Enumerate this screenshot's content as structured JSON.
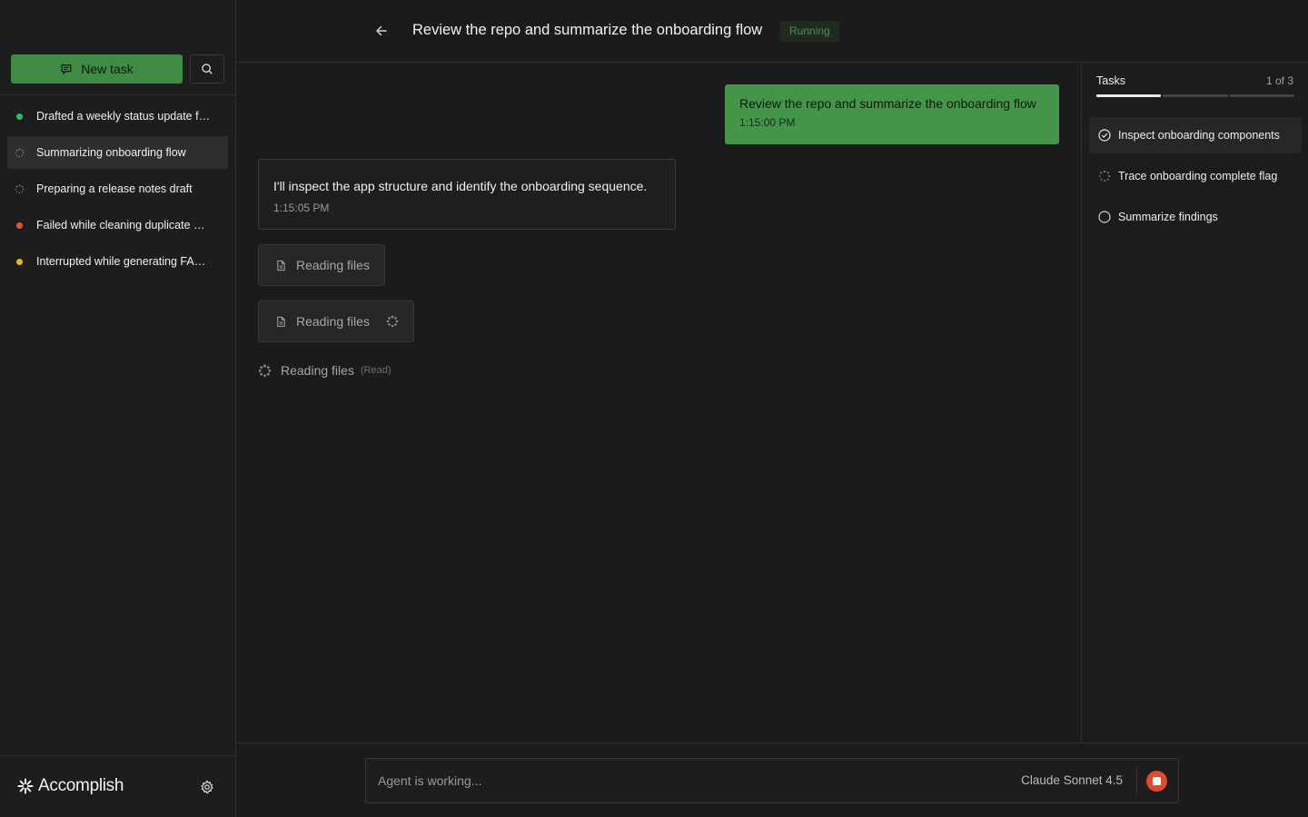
{
  "sidebar": {
    "new_task_label": "New task",
    "tasks": [
      {
        "label": "Drafted a weekly status update for the team",
        "status": "completed",
        "color": "#2fbf5a"
      },
      {
        "label": "Summarizing onboarding flow",
        "status": "running",
        "color": "#8a8a8a"
      },
      {
        "label": "Preparing a release notes draft",
        "status": "running",
        "color": "#8a8a8a"
      },
      {
        "label": "Failed while cleaning duplicate entries",
        "status": "failed",
        "color": "#e8503a"
      },
      {
        "label": "Interrupted while generating FAQ answers",
        "status": "interrupted",
        "color": "#e8b420"
      }
    ],
    "brand": "Accomplish"
  },
  "header": {
    "title": "Review the repo and summarize the onboarding flow",
    "status": "Running"
  },
  "chat": {
    "user_message": {
      "text": "Review the repo and summarize the onboarding flow",
      "time": "1:15:00 PM"
    },
    "agent_message": {
      "text": "I'll inspect the app structure and identify the onboarding sequence.",
      "time": "1:15:05 PM"
    },
    "tool_calls": [
      {
        "label": "Reading files",
        "running": false
      },
      {
        "label": "Reading files",
        "running": true
      }
    ],
    "tool_inline": {
      "label": "Reading files",
      "detail": "(Read)"
    }
  },
  "tasks_panel": {
    "title": "Tasks",
    "count": "1 of 3",
    "progress": {
      "completed": 1,
      "total": 3
    },
    "items": [
      {
        "label": "Inspect onboarding components",
        "state": "done"
      },
      {
        "label": "Trace onboarding complete flag",
        "state": "in-progress"
      },
      {
        "label": "Summarize findings",
        "state": "pending"
      }
    ]
  },
  "input": {
    "placeholder": "Agent is working...",
    "model": "Claude Sonnet 4.5"
  },
  "colors": {
    "accent_green": "#44944a",
    "stop_red": "#e04a2e",
    "background": "#1b1b1b"
  }
}
